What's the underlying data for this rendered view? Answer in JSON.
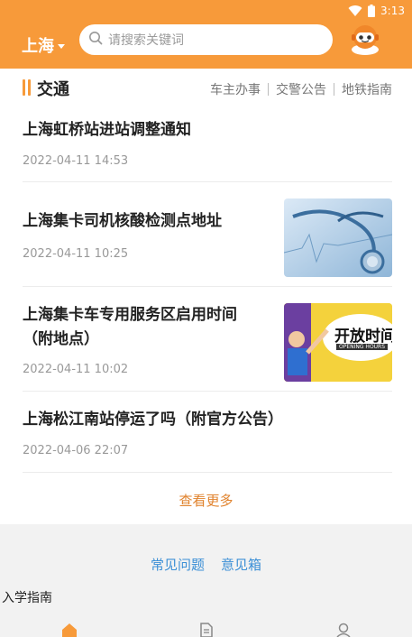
{
  "status_bar": {
    "time": "3:13"
  },
  "header": {
    "city": "上海",
    "search_placeholder": "请搜索关键词"
  },
  "section": {
    "title": "交通",
    "links": [
      "车主办事",
      "交警公告",
      "地铁指南"
    ]
  },
  "news": [
    {
      "title": "上海虹桥站进站调整通知",
      "date": "2022-04-11 14:53",
      "has_image": false
    },
    {
      "title": "上海集卡司机核酸检测点地址",
      "date": "2022-04-11 10:25",
      "has_image": true,
      "image": "stethoscope-photo"
    },
    {
      "title_line1": "上海集卡车专用服务区启用时间",
      "title_line2": "（附地点）",
      "date": "2022-04-11 10:02",
      "has_image": true,
      "image": "opening-hours-illustration",
      "image_text_big": "开放时间",
      "image_text_small": "OPENING HOURS"
    },
    {
      "title": "上海松江南站停运了吗（附官方公告）",
      "date": "2022-04-06 22:07",
      "has_image": false
    }
  ],
  "more_label": "查看更多",
  "footer": {
    "links": [
      "常见问题",
      "意见箱"
    ],
    "guide_label": "入学指南"
  },
  "tabbar": {
    "icons": [
      "home-icon",
      "document-icon",
      "user-icon"
    ],
    "active_color": "#f79a3a"
  },
  "colors": {
    "brand": "#f79a3a",
    "link": "#3b8fd6",
    "more": "#e0822c"
  }
}
